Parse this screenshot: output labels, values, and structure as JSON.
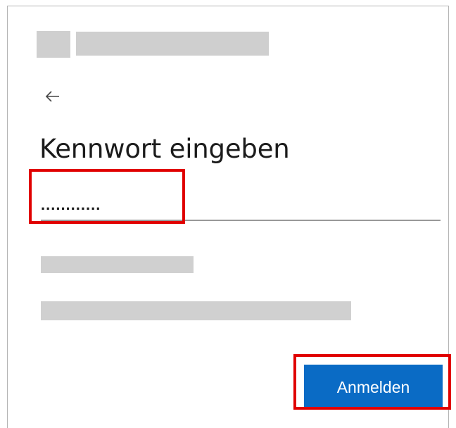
{
  "login": {
    "title": "Kennwort eingeben",
    "password_value": "............",
    "submit_label": "Anmelden"
  },
  "colors": {
    "button_bg": "#0a6bc5",
    "button_text": "#ffffff",
    "highlight": "#e00000",
    "redacted": "#cfcfcf"
  },
  "icons": {
    "back": "arrow-left-icon"
  }
}
